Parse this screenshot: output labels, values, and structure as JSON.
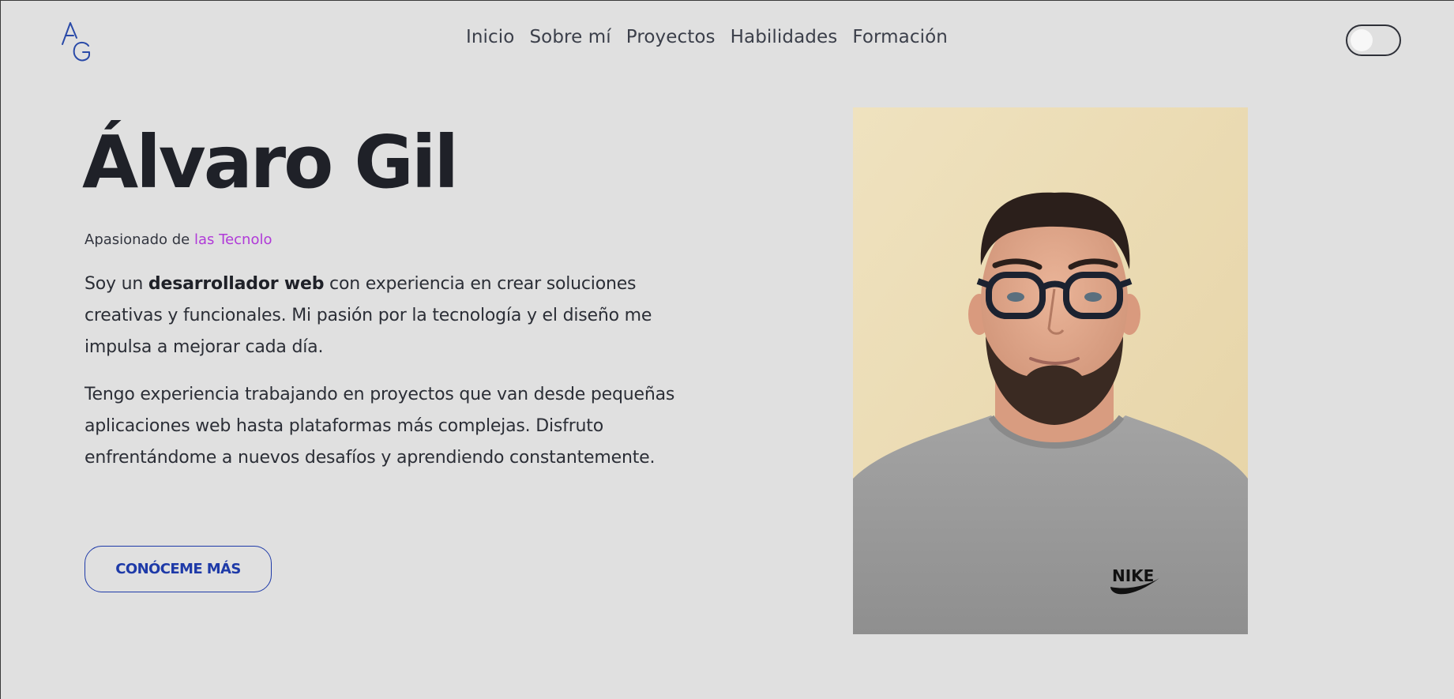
{
  "header": {
    "logo_text": "AG",
    "nav": [
      {
        "label": "Inicio"
      },
      {
        "label": "Sobre mí"
      },
      {
        "label": "Proyectos"
      },
      {
        "label": "Habilidades"
      },
      {
        "label": "Formación"
      }
    ],
    "theme_toggle": {
      "state": "off"
    }
  },
  "hero": {
    "name": "Álvaro Gil",
    "tagline_prefix": "Apasionado de",
    "tagline_typed": "las Tecnolo",
    "para1": {
      "before": "Soy un",
      "bold": "desarrollador web",
      "after": "con experiencia en crear soluciones creativas y funcionales. Mi pasión por la tecnología y el diseño me impulsa a mejorar cada día."
    },
    "para2": "Tengo experiencia trabajando en proyectos que van desde pequeñas aplicaciones web hasta plataformas más complejas. Disfruto enfrentándome a nuevos desafíos y aprendiendo constantemente.",
    "cta_label": "CONÓCEME MÁS"
  },
  "portrait": {
    "shirt_logo": "NIKE"
  },
  "colors": {
    "background": "#e0e0e0",
    "text": "#1f2128",
    "accent_blue": "#1e3aa8",
    "typed_purple": "#b03ad8"
  }
}
